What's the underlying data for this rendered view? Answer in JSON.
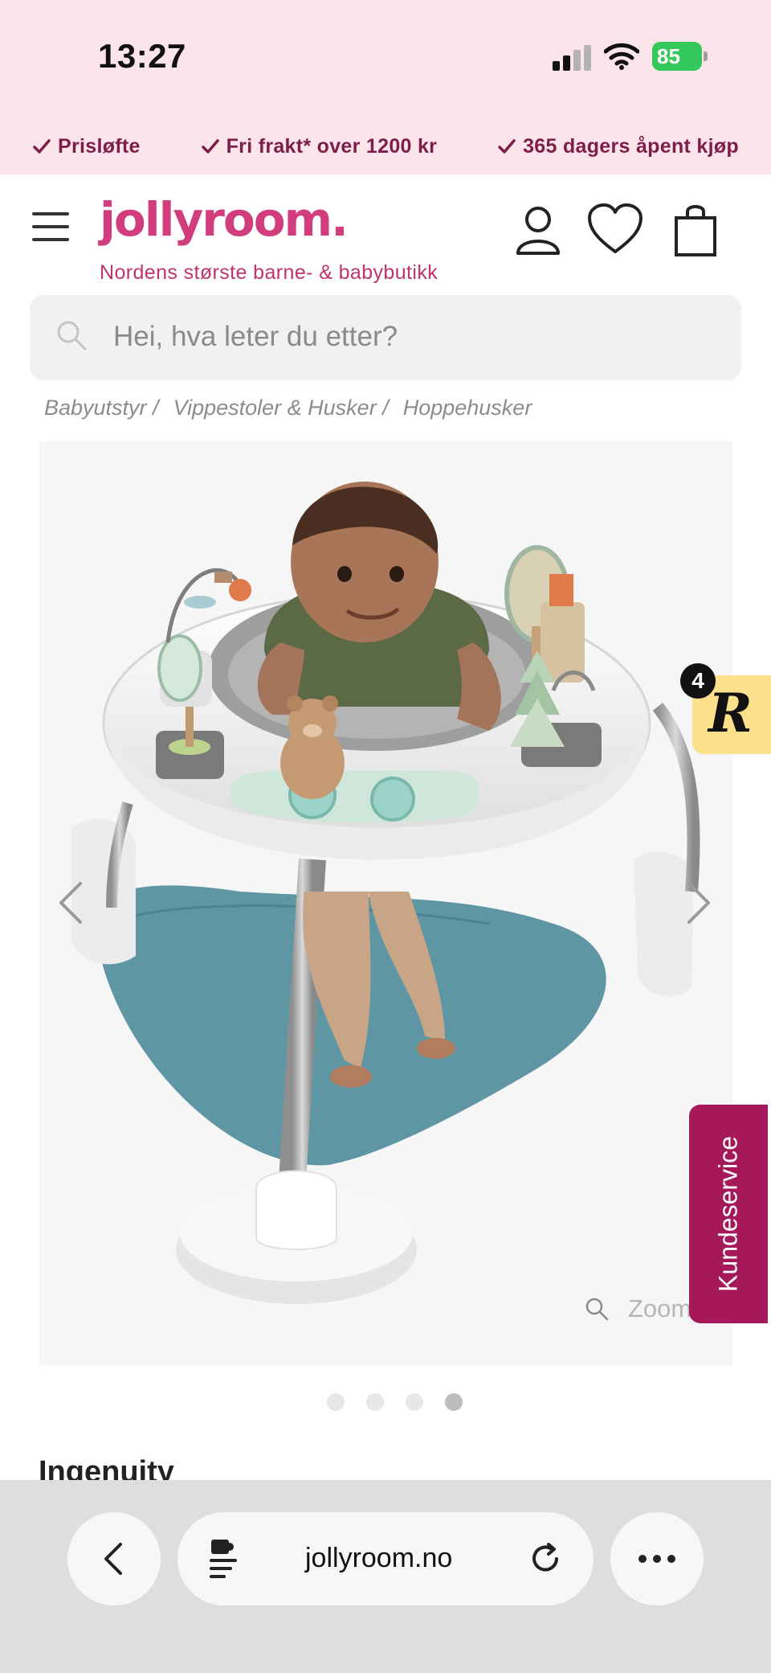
{
  "status_bar": {
    "time": "13:27",
    "battery": "85"
  },
  "usp": [
    {
      "label": "Prisløfte"
    },
    {
      "label": "Fri frakt* over 1200 kr"
    },
    {
      "label": "365 dagers åpent kjøp"
    }
  ],
  "header": {
    "logo": "jollyroom.",
    "tagline": "Nordens største barne- & babybutikk",
    "icons": [
      "user-icon",
      "heart-icon",
      "bag-icon"
    ]
  },
  "search": {
    "placeholder": "Hei, hva leter du etter?"
  },
  "breadcrumb": [
    "Babyutstyr /",
    "Vippestoler & Husker /",
    "Hoppehusker"
  ],
  "product": {
    "zoom_label": "Zoom",
    "carousel": {
      "count": 4,
      "active_index": 3
    },
    "brand": "Ingenuity"
  },
  "widgets": {
    "reviews_count": "4",
    "reviews_logo": "R",
    "support_label": "Kundeservice"
  },
  "browser": {
    "url": "jollyroom.no"
  },
  "colors": {
    "brand_pink": "#d13d7d",
    "usp_text": "#7d1d4a",
    "support_bg": "#a5195a",
    "badge_bg": "#fce08b"
  }
}
